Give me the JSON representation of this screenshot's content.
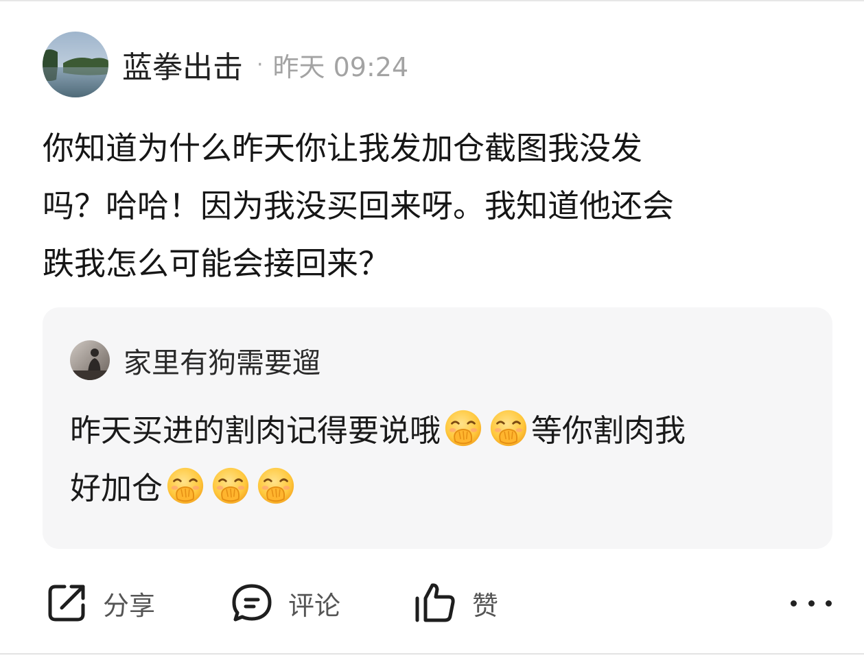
{
  "post": {
    "author": "蓝拳出击",
    "separator": "·",
    "time": "昨天 09:24",
    "body_lines": [
      "你知道为什么昨天你让我发加仓截图我没发",
      "吗？哈哈！因为我没买回来呀。我知道他还会",
      "跌我怎么可能会接回来？"
    ]
  },
  "quoted": {
    "author": "家里有狗需要遛",
    "line1_a": "昨天买进的割肉记得要说哦",
    "line1_b": "等你割肉我",
    "line2_a": "好加仓",
    "emoji": "hand-over-mouth-emoji"
  },
  "actions": {
    "share": {
      "label": "分享",
      "icon": "share-icon"
    },
    "comment": {
      "label": "评论",
      "icon": "comment-icon"
    },
    "like": {
      "label": "赞",
      "icon": "thumbs-up-icon"
    },
    "more": {
      "icon": "more-icon"
    }
  },
  "colors": {
    "card_background": "#f6f6f7",
    "muted_text": "#a3a3a3",
    "emoji_yellow": "#ffc83d"
  }
}
